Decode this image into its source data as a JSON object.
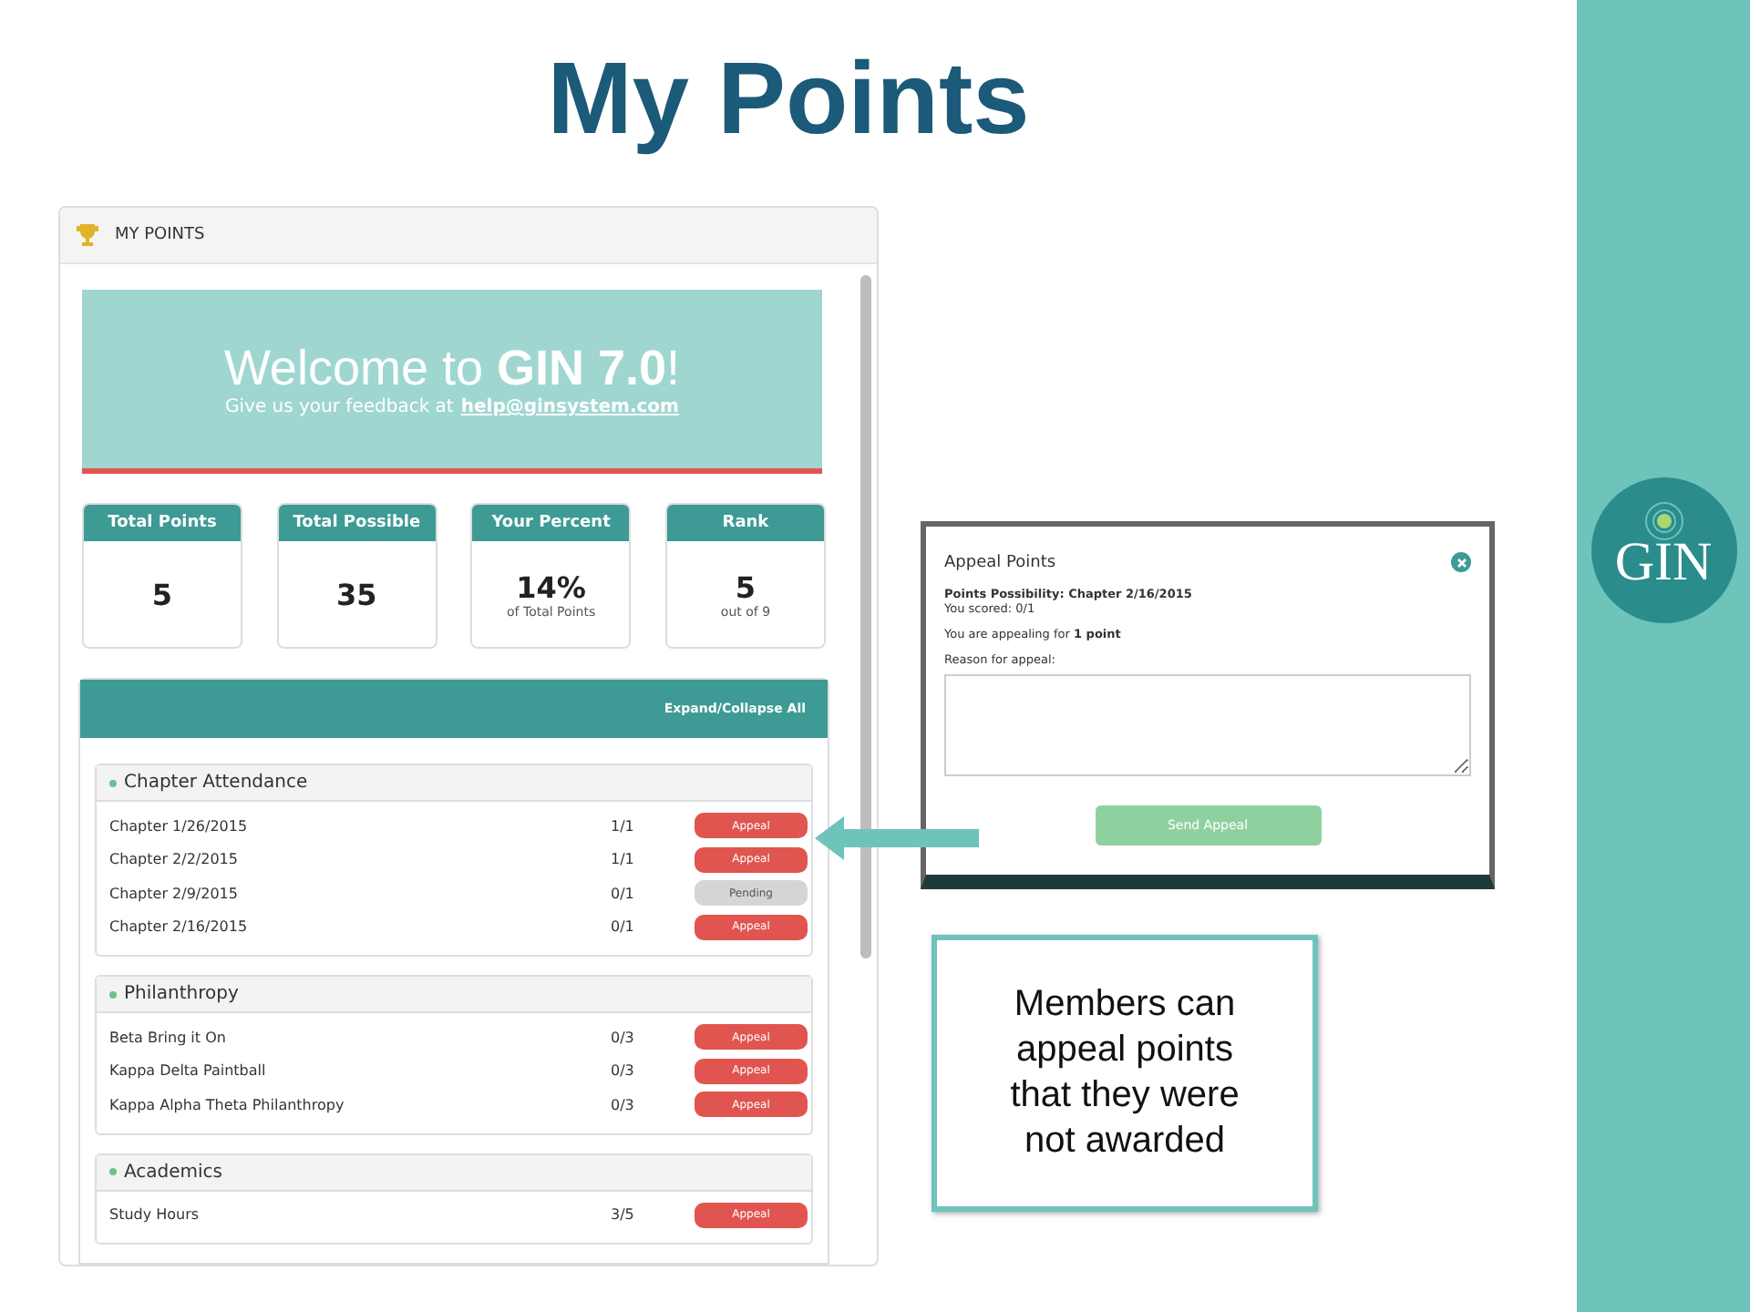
{
  "title": "My Points",
  "app": {
    "header_title": "MY POINTS",
    "banner": {
      "headline": "Welcome to **GIN 7.0**!",
      "subline": "Give us your feedback at",
      "link": "help@ginsystem.com"
    },
    "stats": [
      {
        "label": "Total Points",
        "value": "5"
      },
      {
        "label": "Total Possible",
        "value": "35"
      },
      {
        "label": "Your Percent",
        "value": "14%",
        "note": "of Total Points"
      },
      {
        "label": "Rank",
        "value": "5",
        "note": "out of 9"
      }
    ],
    "expand_label": "Expand/Collapse All",
    "groups": [
      {
        "name": "Chapter Attendance",
        "items": [
          {
            "name": "Chapter 1/26/2015",
            "score": "1/1",
            "action": {
              "kind": "appeal",
              "label": "Appeal"
            }
          },
          {
            "name": "Chapter 2/2/2015",
            "score": "1/1",
            "action": {
              "kind": "appeal",
              "label": "Appeal"
            }
          },
          {
            "name": "Chapter 2/9/2015",
            "score": "0/1",
            "action": {
              "kind": "pending",
              "label": "Pending"
            }
          },
          {
            "name": "Chapter 2/16/2015",
            "score": "0/1",
            "action": {
              "kind": "appeal",
              "label": "Appeal"
            }
          }
        ]
      },
      {
        "name": "Philanthropy",
        "items": [
          {
            "name": "Beta Bring it On",
            "score": "0/3",
            "action": {
              "kind": "appeal",
              "label": "Appeal"
            }
          },
          {
            "name": "Kappa Delta Paintball",
            "score": "0/3",
            "action": {
              "kind": "appeal",
              "label": "Appeal"
            }
          },
          {
            "name": "Kappa Alpha Theta Philanthropy",
            "score": "0/3",
            "action": {
              "kind": "appeal",
              "label": "Appeal"
            }
          }
        ]
      },
      {
        "name": "Academics",
        "items": [
          {
            "name": "Study Hours",
            "score": "3/5",
            "action": {
              "kind": "appeal",
              "label": "Appeal"
            }
          }
        ]
      }
    ]
  },
  "modal": {
    "title": "Appeal Points",
    "possibility": "Points Possibility: Chapter 2/16/2015",
    "scored": "You scored: 0/1",
    "appealing": "You are appealing for **1 point**",
    "reason_label": "Reason for appeal:",
    "button": "Send Appeal"
  },
  "callout": "Members can appeal points that they were not awarded",
  "logo": "GIN"
}
